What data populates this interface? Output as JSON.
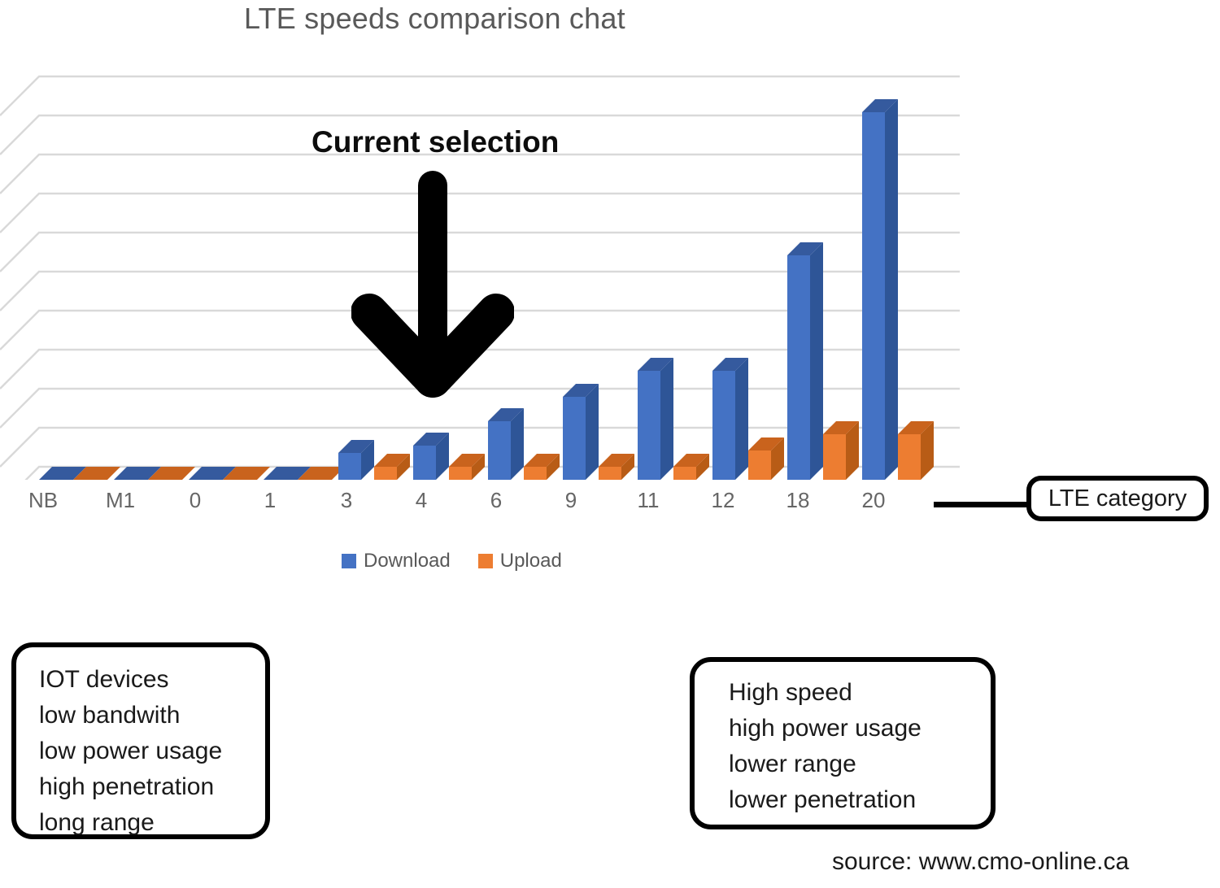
{
  "title": "LTE speeds comparison chat",
  "annotation": {
    "current_selection_label": "Current selection",
    "arrow_icon": "down-arrow-icon"
  },
  "axis": {
    "category_box_label": "LTE category"
  },
  "legend": {
    "items": [
      {
        "label": "Download",
        "color": "#4472C4",
        "icon": "blue-square-icon"
      },
      {
        "label": "Upload",
        "color": "#ED7D31",
        "icon": "orange-square-icon"
      }
    ]
  },
  "callouts": {
    "low_end": {
      "lines": [
        "IOT devices",
        "low bandwith",
        "low power usage",
        "high penetration",
        "long range"
      ]
    },
    "high_end": {
      "lines": [
        "High speed",
        "high power usage",
        "lower range",
        "lower penetration"
      ]
    }
  },
  "source": "source: www.cmo-online.ca",
  "colors": {
    "download_front": "#4472C4",
    "download_side": "#2E5597",
    "download_top": "#355A9E",
    "upload_front": "#ED7D31",
    "upload_side": "#B85C16",
    "upload_top": "#C9631D",
    "gridline": "#D9D9D9",
    "title_text": "#595959",
    "tick_text": "#666666"
  },
  "chart_data": {
    "type": "bar",
    "title": "LTE speeds comparison chat",
    "xlabel": "LTE category",
    "ylabel": "",
    "grid": true,
    "legend_position": "bottom",
    "three_d": true,
    "categories": [
      "NB",
      "M1",
      "0",
      "1",
      "3",
      "4",
      "6",
      "9",
      "11",
      "12",
      "18",
      "20"
    ],
    "series": [
      {
        "name": "Download",
        "color": "#4472C4",
        "values": [
          0.2,
          0.3,
          1,
          10,
          24,
          30,
          50,
          60,
          75,
          75,
          200,
          400
        ]
      },
      {
        "name": "Upload",
        "color": "#ED7D31",
        "values": [
          0.2,
          0.4,
          1,
          5,
          10,
          10,
          10,
          10,
          10,
          20,
          50,
          50
        ]
      }
    ],
    "ylim": [
      0,
      440
    ],
    "y_tick_count": 10,
    "notes": "3-D clustered column chart; Y axis values are unlabeled, bar heights read from gridlines."
  }
}
